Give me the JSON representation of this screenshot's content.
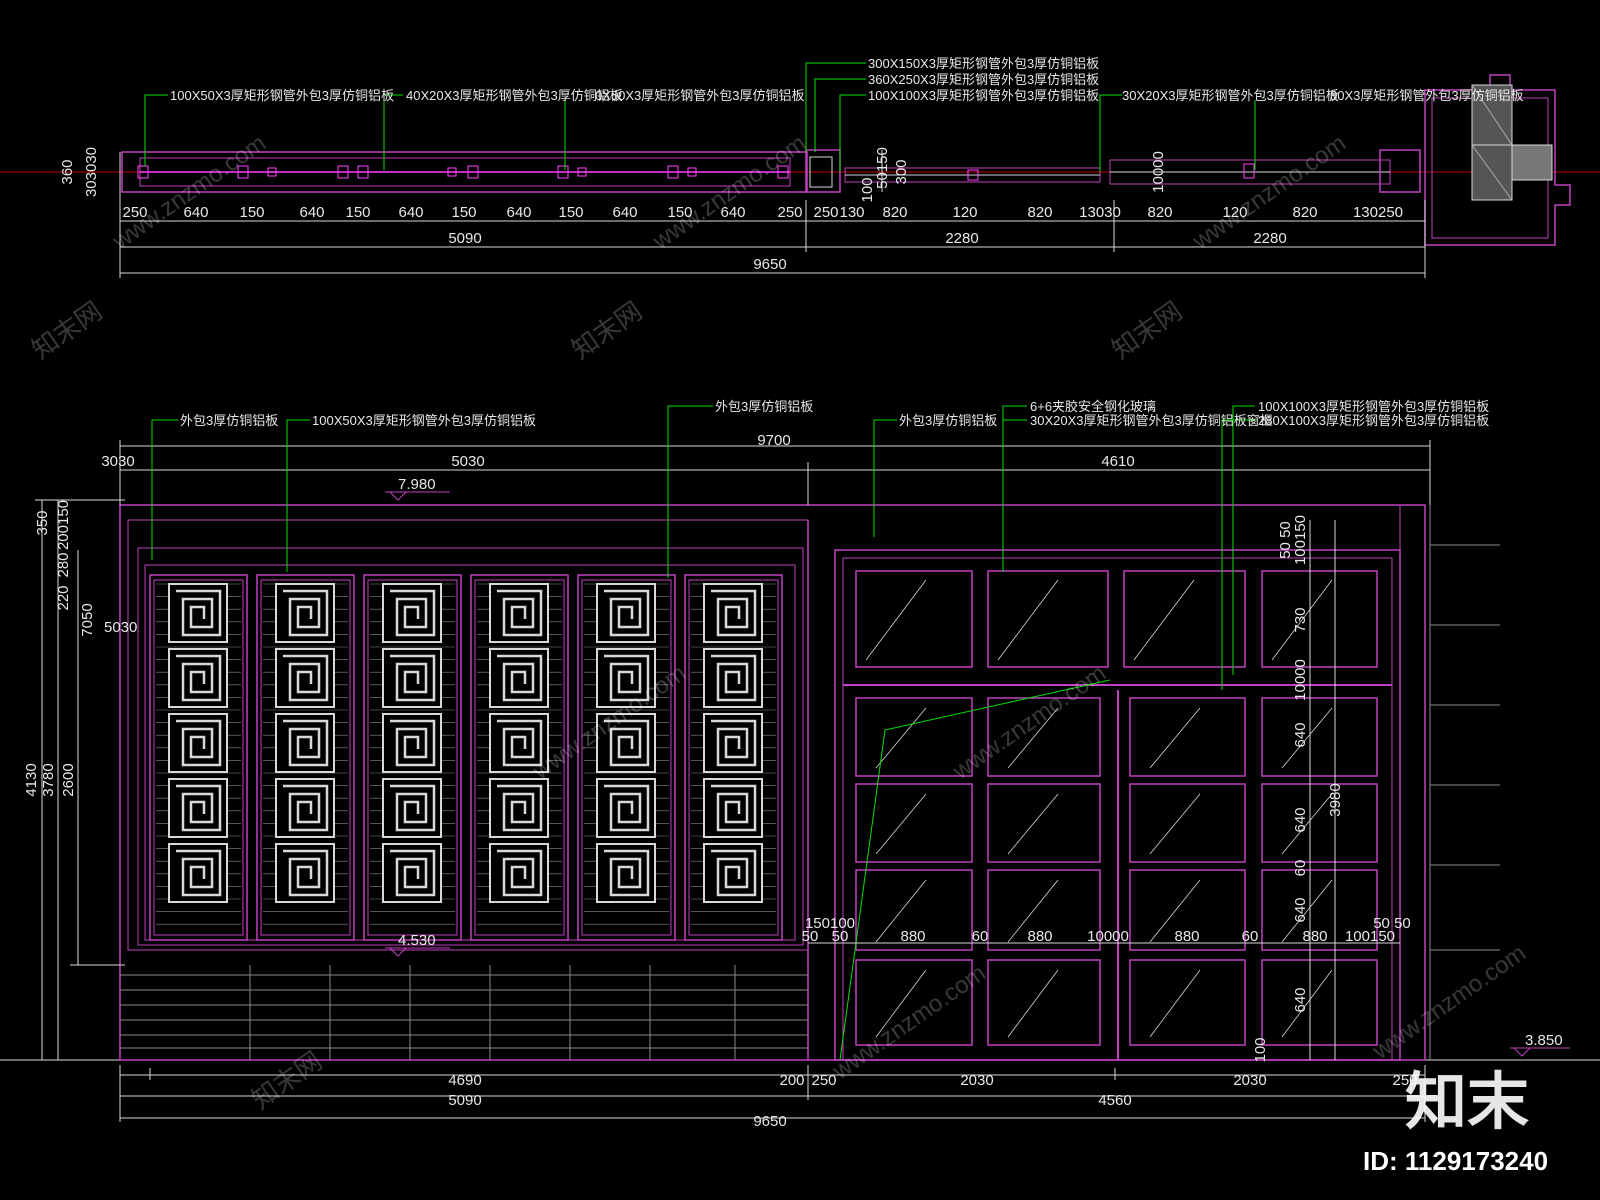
{
  "colors": {
    "background": "#000000",
    "frame": "#c040c0",
    "leader": "#00e000",
    "line": "#d8d8d8",
    "axis": "#c00000",
    "hatch": "#8a8a8a",
    "text": "#e8e8e8"
  },
  "plan": {
    "callouts": [
      "100X50X3厚矩形钢管外包3厚仿铜铝板",
      "40X20X3厚矩形钢管外包3厚仿铜铝板",
      "0X50X3厚矩形钢管外包3厚仿铜铝板",
      "300X150X3厚矩形钢管外包3厚仿铜铝板",
      "360X250X3厚矩形钢管外包3厚仿铜铝板",
      "100X100X3厚矩形钢管外包3厚仿铜铝板",
      "30X20X3厚矩形钢管外包3厚仿铜铝板",
      "80X3厚矩形钢管外包3厚仿铜铝板"
    ],
    "dims_row1": [
      "250",
      "640",
      "150",
      "640",
      "150",
      "640",
      "150",
      "640",
      "150",
      "640",
      "150",
      "640",
      "250",
      "250",
      "130",
      "820",
      "120",
      "820",
      "13030",
      "820",
      "120",
      "820",
      "130250"
    ],
    "dims_row2": [
      "5090",
      "2280",
      "2280"
    ],
    "dims_total": "9650",
    "side_dims": [
      "360",
      "303030"
    ],
    "mid_dims": [
      "100",
      "50150",
      "300"
    ],
    "right_dim": "10000"
  },
  "elevation": {
    "callouts": [
      "外包3厚仿铜铝板",
      "100X50X3厚矩形钢管外包3厚仿铜铝板",
      "外包3厚仿铜铝板",
      "外包3厚仿铜铝板",
      "6+6夹胶安全钢化玻璃",
      "30X20X3厚矩形钢管外包3厚仿铜铝板窗框",
      "100X100X3厚矩形钢管外包3厚仿铜铝板",
      "280X100X3厚矩形钢管外包3厚仿铜铝板"
    ],
    "top_dims": {
      "overall": "9700",
      "left_small": "3030",
      "left": "5030",
      "right": "4610"
    },
    "levels": {
      "top": "7.980",
      "mid": "4.530",
      "right": "3.850"
    },
    "left_dims": {
      "overall": "4130",
      "a": "3780",
      "b": "2600",
      "stack": [
        "350",
        "200150",
        "280",
        "220",
        "7050"
      ],
      "small": "5030"
    },
    "right_dims": [
      "50 50",
      "100150",
      "730",
      "10000",
      "640",
      "640",
      "60",
      "640",
      "640",
      "100",
      "3980"
    ],
    "mid_dims": [
      "150100",
      "50",
      "50",
      "880",
      "60",
      "880",
      "10000",
      "880",
      "60",
      "880",
      "100150",
      "50 50"
    ],
    "bottom_row1": [
      "4690",
      "200",
      "250",
      "2030",
      "2030",
      "250"
    ],
    "bottom_row2": [
      "5090",
      "4560"
    ],
    "bottom_total": "9650"
  },
  "watermark": {
    "text": "www.znzmo.com",
    "logo": "知末",
    "site": "知末网",
    "id": "ID: 1129173240"
  }
}
